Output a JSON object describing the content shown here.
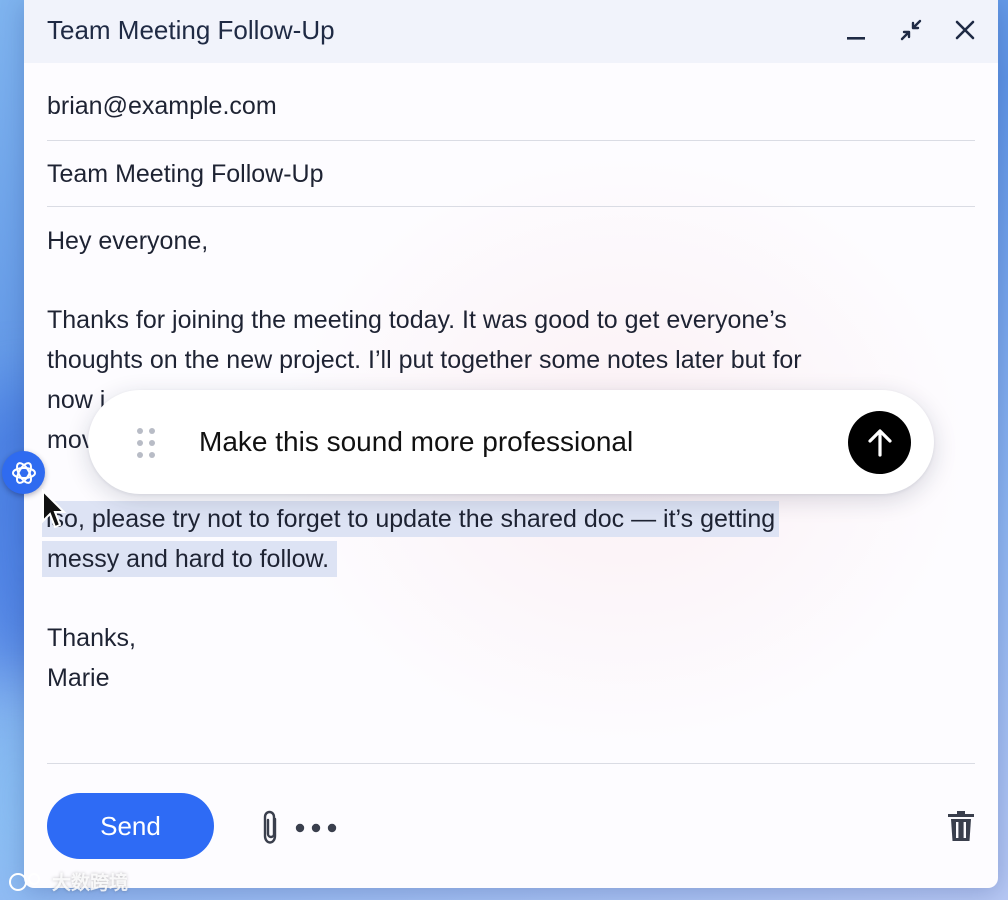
{
  "window": {
    "title": "Team Meeting Follow-Up"
  },
  "fields": {
    "to": "brian@example.com",
    "subject": "Team Meeting Follow-Up"
  },
  "body": {
    "greeting": "Hey everyone,",
    "paragraph1_line1": "Thanks for joining the meeting today. It was good to get everyone’s",
    "paragraph1_line2": "thoughts on the new project. I’ll put together some notes later but for",
    "paragraph1_line3_partial": "now i",
    "paragraph1_line4_partial": "mov",
    "selected_line1_visible": "lso, please try not to forget to update the shared doc — it’s getting",
    "selected_line2": "messy and hard to follow.",
    "signoff": "Thanks,",
    "signature": "Marie"
  },
  "prompt_bar": {
    "text": "Make this sound more professional"
  },
  "footer": {
    "send_label": "Send"
  },
  "watermark": {
    "text": "大数跨境"
  },
  "colors": {
    "accent": "#2e6bf5",
    "assistant": "#2f6bf0",
    "selection": "#dde3f4"
  },
  "icons": {
    "minimize": "minimize-icon",
    "collapse": "collapse-icon",
    "close": "close-icon",
    "drag": "drag-handle-icon",
    "submit": "arrow-up-icon",
    "assistant": "assistant-icon",
    "attach": "paperclip-icon",
    "more": "more-options-icon",
    "delete": "trash-icon"
  }
}
